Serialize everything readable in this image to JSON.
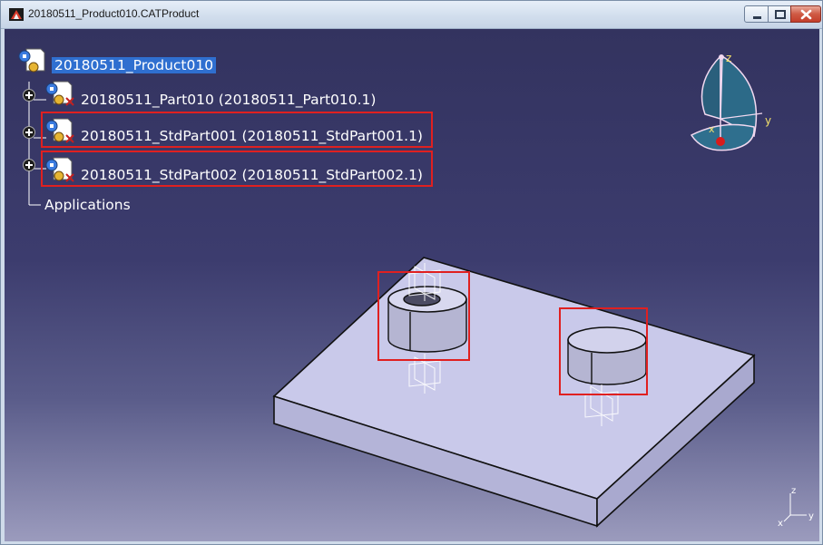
{
  "window": {
    "title": "20180511_Product010.CATProduct",
    "buttons": [
      "minimize",
      "maximize",
      "close"
    ]
  },
  "tree": {
    "root": "20180511_Product010",
    "children": [
      {
        "label": "20180511_Part010 (20180511_Part010.1)",
        "highlighted": false
      },
      {
        "label": "20180511_StdPart001 (20180511_StdPart001.1)",
        "highlighted": true
      },
      {
        "label": "20180511_StdPart002 (20180511_StdPart002.1)",
        "highlighted": true
      }
    ],
    "applications": "Applications"
  },
  "compass": {
    "z": "z",
    "y": "y",
    "x": "x"
  },
  "axis_triad": {
    "z": "z",
    "x": "x",
    "y": "y"
  },
  "colors": {
    "highlight_box": "#e02020",
    "background_top": "#33335f",
    "background_bottom": "#9b9bbd",
    "part_face": "#c9c9ea",
    "selection": "#2f6fd0"
  }
}
